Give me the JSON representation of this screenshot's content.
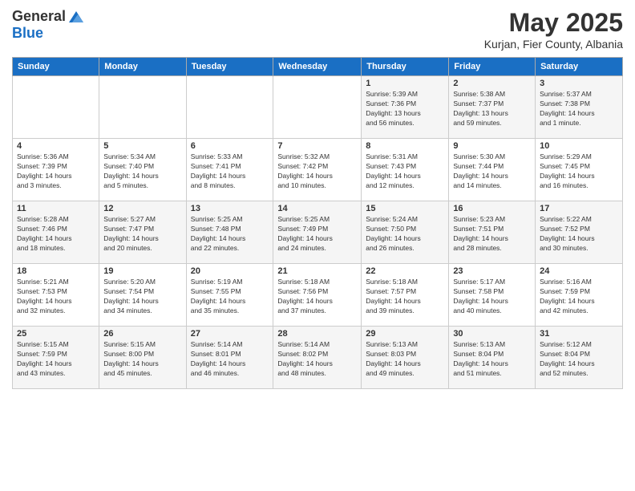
{
  "logo": {
    "general": "General",
    "blue": "Blue"
  },
  "header": {
    "title": "May 2025",
    "subtitle": "Kurjan, Fier County, Albania"
  },
  "weekdays": [
    "Sunday",
    "Monday",
    "Tuesday",
    "Wednesday",
    "Thursday",
    "Friday",
    "Saturday"
  ],
  "weeks": [
    [
      {
        "day": "",
        "info": ""
      },
      {
        "day": "",
        "info": ""
      },
      {
        "day": "",
        "info": ""
      },
      {
        "day": "",
        "info": ""
      },
      {
        "day": "1",
        "info": "Sunrise: 5:39 AM\nSunset: 7:36 PM\nDaylight: 13 hours\nand 56 minutes."
      },
      {
        "day": "2",
        "info": "Sunrise: 5:38 AM\nSunset: 7:37 PM\nDaylight: 13 hours\nand 59 minutes."
      },
      {
        "day": "3",
        "info": "Sunrise: 5:37 AM\nSunset: 7:38 PM\nDaylight: 14 hours\nand 1 minute."
      }
    ],
    [
      {
        "day": "4",
        "info": "Sunrise: 5:36 AM\nSunset: 7:39 PM\nDaylight: 14 hours\nand 3 minutes."
      },
      {
        "day": "5",
        "info": "Sunrise: 5:34 AM\nSunset: 7:40 PM\nDaylight: 14 hours\nand 5 minutes."
      },
      {
        "day": "6",
        "info": "Sunrise: 5:33 AM\nSunset: 7:41 PM\nDaylight: 14 hours\nand 8 minutes."
      },
      {
        "day": "7",
        "info": "Sunrise: 5:32 AM\nSunset: 7:42 PM\nDaylight: 14 hours\nand 10 minutes."
      },
      {
        "day": "8",
        "info": "Sunrise: 5:31 AM\nSunset: 7:43 PM\nDaylight: 14 hours\nand 12 minutes."
      },
      {
        "day": "9",
        "info": "Sunrise: 5:30 AM\nSunset: 7:44 PM\nDaylight: 14 hours\nand 14 minutes."
      },
      {
        "day": "10",
        "info": "Sunrise: 5:29 AM\nSunset: 7:45 PM\nDaylight: 14 hours\nand 16 minutes."
      }
    ],
    [
      {
        "day": "11",
        "info": "Sunrise: 5:28 AM\nSunset: 7:46 PM\nDaylight: 14 hours\nand 18 minutes."
      },
      {
        "day": "12",
        "info": "Sunrise: 5:27 AM\nSunset: 7:47 PM\nDaylight: 14 hours\nand 20 minutes."
      },
      {
        "day": "13",
        "info": "Sunrise: 5:25 AM\nSunset: 7:48 PM\nDaylight: 14 hours\nand 22 minutes."
      },
      {
        "day": "14",
        "info": "Sunrise: 5:25 AM\nSunset: 7:49 PM\nDaylight: 14 hours\nand 24 minutes."
      },
      {
        "day": "15",
        "info": "Sunrise: 5:24 AM\nSunset: 7:50 PM\nDaylight: 14 hours\nand 26 minutes."
      },
      {
        "day": "16",
        "info": "Sunrise: 5:23 AM\nSunset: 7:51 PM\nDaylight: 14 hours\nand 28 minutes."
      },
      {
        "day": "17",
        "info": "Sunrise: 5:22 AM\nSunset: 7:52 PM\nDaylight: 14 hours\nand 30 minutes."
      }
    ],
    [
      {
        "day": "18",
        "info": "Sunrise: 5:21 AM\nSunset: 7:53 PM\nDaylight: 14 hours\nand 32 minutes."
      },
      {
        "day": "19",
        "info": "Sunrise: 5:20 AM\nSunset: 7:54 PM\nDaylight: 14 hours\nand 34 minutes."
      },
      {
        "day": "20",
        "info": "Sunrise: 5:19 AM\nSunset: 7:55 PM\nDaylight: 14 hours\nand 35 minutes."
      },
      {
        "day": "21",
        "info": "Sunrise: 5:18 AM\nSunset: 7:56 PM\nDaylight: 14 hours\nand 37 minutes."
      },
      {
        "day": "22",
        "info": "Sunrise: 5:18 AM\nSunset: 7:57 PM\nDaylight: 14 hours\nand 39 minutes."
      },
      {
        "day": "23",
        "info": "Sunrise: 5:17 AM\nSunset: 7:58 PM\nDaylight: 14 hours\nand 40 minutes."
      },
      {
        "day": "24",
        "info": "Sunrise: 5:16 AM\nSunset: 7:59 PM\nDaylight: 14 hours\nand 42 minutes."
      }
    ],
    [
      {
        "day": "25",
        "info": "Sunrise: 5:15 AM\nSunset: 7:59 PM\nDaylight: 14 hours\nand 43 minutes."
      },
      {
        "day": "26",
        "info": "Sunrise: 5:15 AM\nSunset: 8:00 PM\nDaylight: 14 hours\nand 45 minutes."
      },
      {
        "day": "27",
        "info": "Sunrise: 5:14 AM\nSunset: 8:01 PM\nDaylight: 14 hours\nand 46 minutes."
      },
      {
        "day": "28",
        "info": "Sunrise: 5:14 AM\nSunset: 8:02 PM\nDaylight: 14 hours\nand 48 minutes."
      },
      {
        "day": "29",
        "info": "Sunrise: 5:13 AM\nSunset: 8:03 PM\nDaylight: 14 hours\nand 49 minutes."
      },
      {
        "day": "30",
        "info": "Sunrise: 5:13 AM\nSunset: 8:04 PM\nDaylight: 14 hours\nand 51 minutes."
      },
      {
        "day": "31",
        "info": "Sunrise: 5:12 AM\nSunset: 8:04 PM\nDaylight: 14 hours\nand 52 minutes."
      }
    ]
  ]
}
